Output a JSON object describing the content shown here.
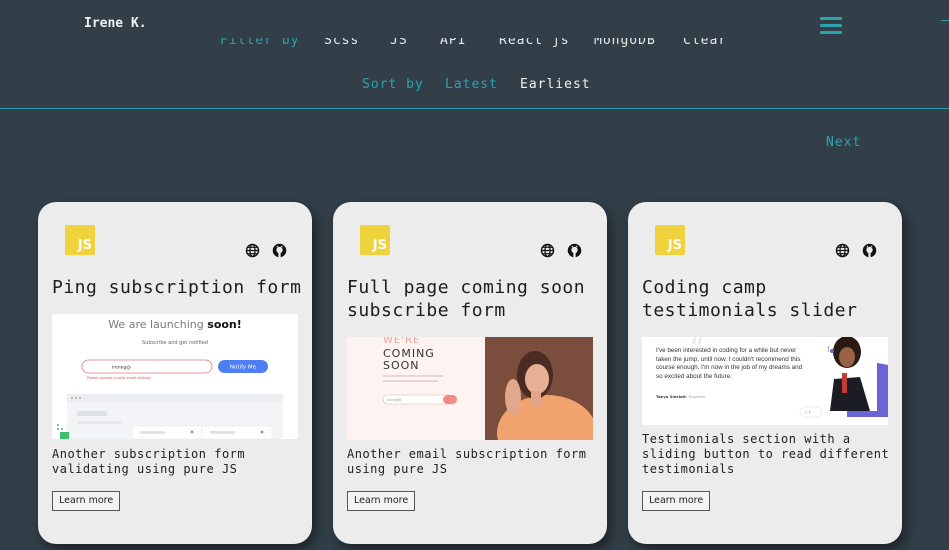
{
  "header": {
    "logo": "Irene K.",
    "menu_icon": "hamburger-icon"
  },
  "filter": {
    "label": "Filter by",
    "options": [
      "Scss",
      "JS",
      "API",
      "React js",
      "MongoDB",
      "Clear"
    ]
  },
  "sort": {
    "label": "Sort by",
    "options": [
      "Latest",
      "Earliest"
    ]
  },
  "pagination": {
    "next": "Next"
  },
  "colors": {
    "accent": "#2aa3ad",
    "background": "#323f48",
    "card": "#ececec",
    "js_badge": "#f0d23c"
  },
  "cards": [
    {
      "badge": "JS",
      "title": "Ping subscription form",
      "description": "Another subscription form validating using pure JS",
      "button": "Learn more",
      "preview": {
        "heading_plain": "We are launching",
        "heading_bold": "soon!",
        "subtext": "Subscribe and get notified",
        "input_value": "ireneg@",
        "error": "Please provide a valid email address",
        "button": "Notify Me"
      }
    },
    {
      "badge": "JS",
      "title": "Full page coming soon subscribe form",
      "description": "Another email subscription form using pure JS",
      "button": "Learn more",
      "preview": {
        "line1": "WE'RE",
        "line2": "COMING",
        "line3": "SOON",
        "input_value": "ireneg@"
      }
    },
    {
      "badge": "JS",
      "title": "Coding camp testimonials slider",
      "description": "Testimonials section with a sliding button to read different testimonials",
      "button": "Learn more",
      "preview": {
        "quote": "I've been interested in coding for a while but never taken the jump, until now. I couldn't recommend this course enough. I'm now in the job of my dreams and so excited about the future.",
        "name": "Tanya Sinclair",
        "role": "UX Engineer"
      }
    }
  ]
}
